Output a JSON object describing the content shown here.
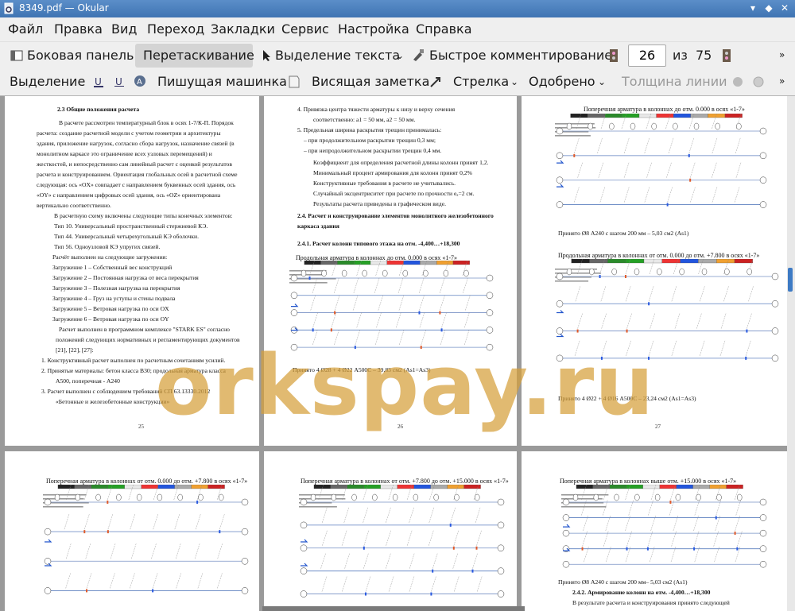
{
  "window": {
    "title": "8349.pdf — Okular"
  },
  "menu": [
    "Файл",
    "Правка",
    "Вид",
    "Переход",
    "Закладки",
    "Сервис",
    "Настройка",
    "Справка"
  ],
  "toolbar1": {
    "sidebar": "Боковая панель",
    "drag": "Перетаскивание",
    "text_select": "Выделение текста",
    "quick_annot": "Быстрое комментирование",
    "page_current": "26",
    "page_of": "из",
    "page_total": "75"
  },
  "toolbar2": {
    "select": "Выделение",
    "typewriter": "Пишущая машинка",
    "note": "Висящая заметка",
    "arrow": "Стрелка",
    "approved": "Одобрено",
    "line_width": "Толщина линии"
  },
  "watermark": "orkspay.ru",
  "pages": {
    "p25": {
      "number": "25",
      "lines": [
        "2.3 Общие положения расчета",
        "В расчете рассмотрен температурный блок в осях 1-7/К-П. Порядок",
        "расчета: создание расчетной модели с учетом геометрии и архитектуры",
        "здания, приложение нагрузок, согласно сбора нагрузок, назначение связей (в",
        "монолитном каркасе это ограничение всех узловых перемещений) и",
        "жесткостей, и  непосредственно сам линейный расчет с оценкой результатов",
        "расчета и конструированием. Ориентация глобальных осей в расчетной схеме",
        "следующая: ось «OX» совпадает с направлением буквенных осей здания, ось",
        "«OY» с направлением цифровых осей здания, ось «OZ» ориентирована",
        "вертикально соответственно.",
        "В расчетную схему включены следующие типы конечных элементов:",
        "Тип 10. Универсальный пространственный стержневой КЭ.",
        "Тип 44. Универсальный четырехугольный КЭ оболочки.",
        "Тип 56. Одноузловой КЭ упругих связей.",
        "Расчёт выполнен на следующие загружения:",
        "Загружение 1 – Собственный вес конструкций",
        "Загружение 2 – Постоянная нагрузка от веса перекрытия",
        "Загружение 3 – Полезная нагрузка на перекрытия",
        "Загружение 4 – Груз на уступы и стены подвала",
        "Загружение 5 – Ветровая нагрузка по оси OX",
        "Загружение 6 – Ветровая нагрузка по оси OY",
        "Расчет выполнен в программном комплексе \"STARK ES\" согласно",
        "положений следующих нормативных и регламентирующих документов",
        "[21], [22], [27]:",
        "1.   Конструктивный расчет выполнен по расчетным сочетаниям усилий.",
        "2.   Принятые материалы: бетон класса В30; продольная арматура класса",
        "А500, поперечная - А240",
        "3.   Расчет выполнен с соблюдением требований СП 63.13330.2012",
        "«Бетонные и железобетонные конструкции»"
      ]
    },
    "p26": {
      "number": "26",
      "lines": [
        "4.   Привязка центра тяжести арматуры к низу и верху сечения",
        "соответственно: a1 = 50 мм, a2 = 50 мм.",
        "5.   Предельная ширина раскрытия трещин принималась:",
        "– при продолжительном раскрытии трещин                    0,3  мм;",
        "– при непродолжительном раскрытии трещин                  0,4  мм.",
        "Коэффициент для определения расчетной длины колонн принят 1,2.",
        "Минимальный процент армирования для колонн принят 0,2%",
        "Конструктивные требования в расчете не учитывались.",
        "Случайный эксцентриситет при расчете по прочности eₐ=2 см.",
        "Результаты расчета приведены в графическом виде.",
        "2.4. Расчет и конструирование элементов монолитного железобетонного",
        "каркаса здания",
        "2.4.1. Расчет колонн типового этажа на отм. -4,400…+18,300"
      ],
      "diagram_title": "Продольная арматура в колоннах до отм. 0.000 в осях «1-7»",
      "caption": "Принято 4 Ø28 + 4 Ø22 А500С – 39,83 см2  (As1=As3)"
    },
    "p27": {
      "number": "27",
      "diagram1_title": "Поперечная арматура в колоннах до отм. 0.000 в осях «1-7»",
      "caption1": "Принято Ø8 А240 с шагом 200 мм – 5,03 см2  (As1)",
      "diagram2_title": "Продольная арматура в колоннах от отм. 0.000 до отм. +7.800 в осях «1-7»",
      "caption2": "Принято 4 Ø22 + 4 Ø16 А500С – 23,24 см2  (As1=As3)"
    },
    "p28": {
      "diagram_title": "Поперечная арматура в колоннах от отм. 0.000  до отм. +7.800  в осях «1-7»"
    },
    "p29": {
      "diagram_title": "Поперечная арматура в колоннах от отм. +7.800  до отм. +15.000 в осях «1-7»"
    },
    "p30": {
      "diagram_title": "Поперечная арматура в колоннах выше отм. +15.000 в осях «1-7»",
      "caption": "Принято Ø8 А240 с шагом 200 мм– 5,03 см2  (As1)",
      "heading": "2.4.2. Армирование колонн  на отм. -4,400…+18,300",
      "text": "В результате расчета и конструирования принято следующей"
    }
  },
  "colors": {
    "accent": "#3d7ac4",
    "titlebar": "#4a80bf",
    "watermark": "#d6a03a"
  }
}
